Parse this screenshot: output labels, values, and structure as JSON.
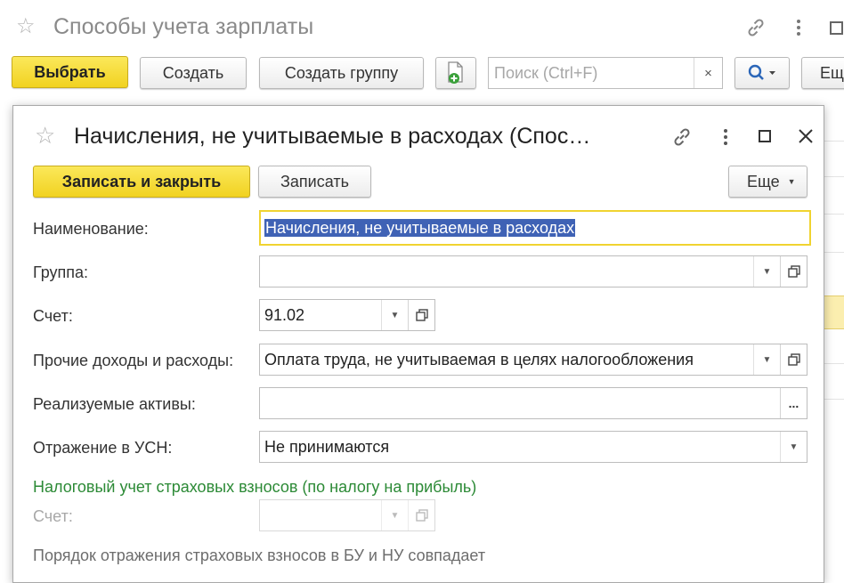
{
  "list_window": {
    "title": "Способы учета зарплаты",
    "toolbar": {
      "select_label": "Выбрать",
      "create_label": "Создать",
      "create_group_label": "Создать группу",
      "search_placeholder": "Поиск (Ctrl+F)",
      "search_clear": "×",
      "more_label": "Ещ"
    },
    "icons": [
      "star-icon",
      "link-icon",
      "kebab-menu-icon",
      "maximize-icon",
      "add-document-icon",
      "search-icon"
    ]
  },
  "dialog": {
    "title": "Начисления, не учитываемые в расходах (Спос…",
    "toolbar": {
      "save_close_label": "Записать и закрыть",
      "save_label": "Записать",
      "more_label": "Еще"
    },
    "fields": {
      "name": {
        "label": "Наименование:",
        "value": "Начисления, не учитываемые в расходах"
      },
      "group": {
        "label": "Группа:",
        "value": ""
      },
      "account": {
        "label": "Счет:",
        "value": "91.02"
      },
      "other_income": {
        "label": "Прочие доходы и расходы:",
        "value": "Оплата труда, не учитываемая в целях налогообложения"
      },
      "assets": {
        "label": "Реализуемые активы:",
        "value": "",
        "button": "..."
      },
      "usn": {
        "label": "Отражение в УСН:",
        "value": "Не принимаются"
      }
    },
    "insurance_section": {
      "heading": "Налоговый учет страховых взносов (по налогу на прибыль)",
      "account_label": "Счет:",
      "account_value": "",
      "note": "Порядок отражения страховых взносов в БУ и НУ совпадает"
    },
    "colors": {
      "accent_yellow": "#f1d221",
      "selection_blue": "#3f62b5",
      "heading_green": "#2c8a36"
    }
  }
}
